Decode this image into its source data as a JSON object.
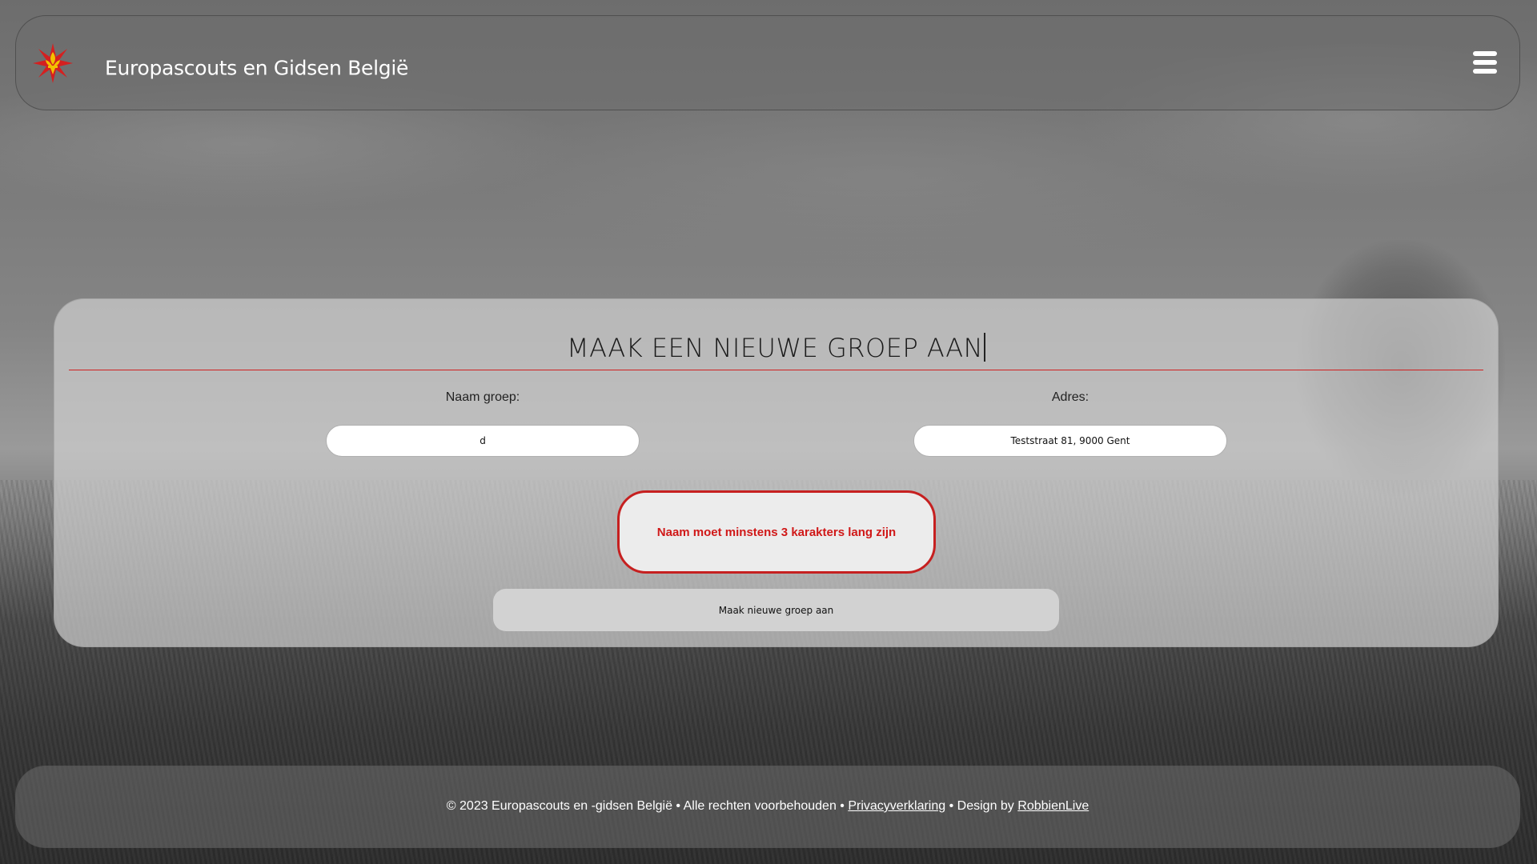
{
  "header": {
    "site_title": "Europascouts en Gidsen België",
    "logo_icon": "scout-lily-star-logo",
    "menu_icon": "hamburger-menu-icon"
  },
  "form": {
    "title": "MAAK EEN NIEUWE GROEP AAN",
    "name_label": "Naam groep:",
    "name_value": "d",
    "address_label": "Adres:",
    "address_value": "Teststraat 81, 9000 Gent",
    "error_message": "Naam moet minstens 3 karakters lang zijn",
    "submit_label": "Maak nieuwe groep aan"
  },
  "footer": {
    "copyright": "© 2023 Europascouts en -gidsen België • Alle rechten voorbehouden •",
    "privacy_link": "Privacyverklaring",
    "design_text": "• Design by",
    "designer_link": "RobbienLive"
  },
  "colors": {
    "accent_red": "#d01818",
    "rule_red": "#d02020",
    "logo_yellow": "#f2c200"
  }
}
